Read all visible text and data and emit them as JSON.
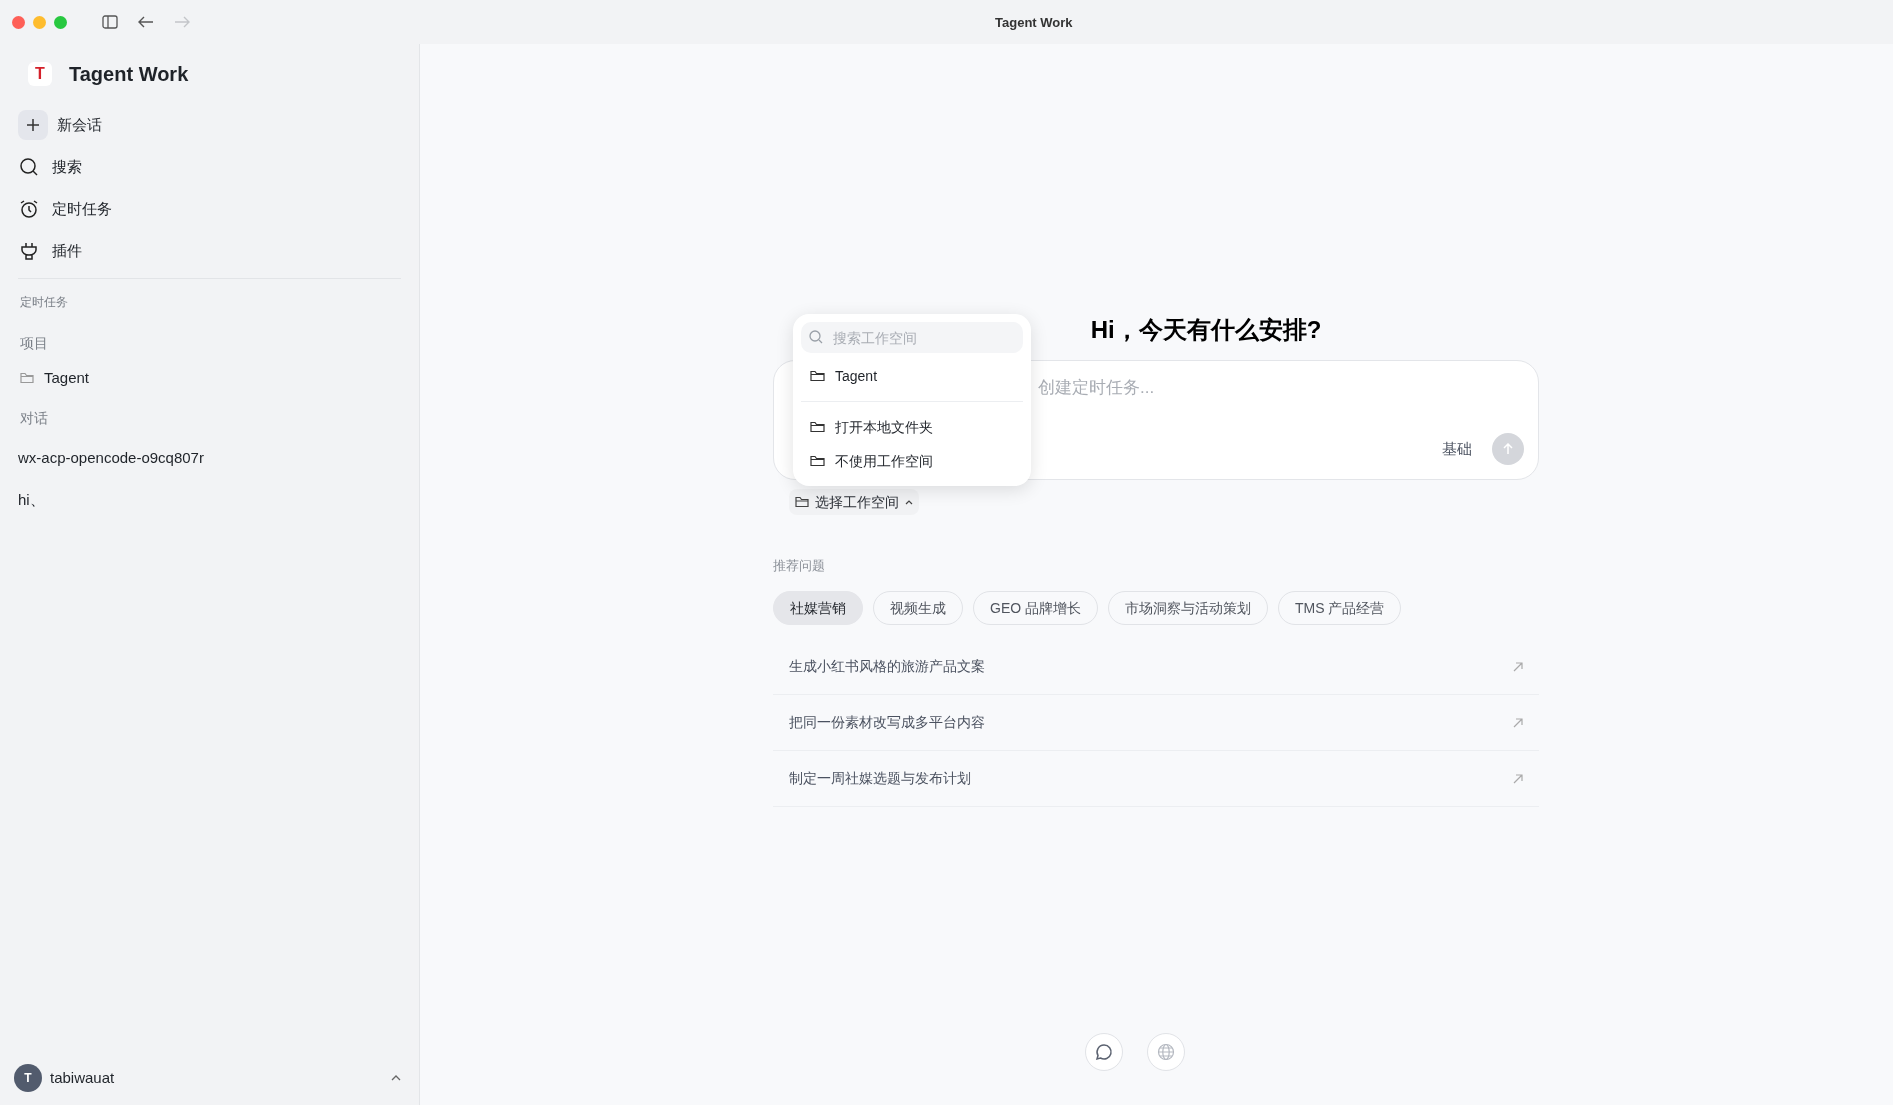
{
  "window": {
    "title": "Tagent Work"
  },
  "sidebar": {
    "logo": "T",
    "app_name": "Tagent Work",
    "nav": [
      {
        "label": "新会话",
        "kind": "new"
      },
      {
        "label": "搜索",
        "kind": "search"
      },
      {
        "label": "定时任务",
        "kind": "clock"
      },
      {
        "label": "插件",
        "kind": "plug"
      }
    ],
    "scheduled_heading": "定时任务",
    "projects_heading": "项目",
    "projects": [
      {
        "label": "Tagent"
      }
    ],
    "conversations_heading": "对话",
    "conversations": [
      {
        "label": "wx-acp-opencode-o9cq807r"
      },
      {
        "label": "hi、"
      }
    ],
    "user": {
      "initial": "T",
      "name": "tabiwauat"
    }
  },
  "main": {
    "greeting": "Hi，今天有什么安排?",
    "composer": {
      "placeholder": "创建定时任务...",
      "mode": "基础"
    },
    "workspace_button": "选择工作空间",
    "workspace_menu": {
      "search_placeholder": "搜索工作空间",
      "items": [
        {
          "label": "Tagent"
        }
      ],
      "actions": [
        {
          "label": "打开本地文件夹"
        },
        {
          "label": "不使用工作空间"
        }
      ]
    },
    "suggestions_heading": "推荐问题",
    "categories": [
      {
        "label": "社媒营销",
        "selected": true
      },
      {
        "label": "视频生成",
        "selected": false
      },
      {
        "label": "GEO 品牌增长",
        "selected": false
      },
      {
        "label": "市场洞察与活动策划",
        "selected": false
      },
      {
        "label": "TMS 产品经营",
        "selected": false
      }
    ],
    "prompts": [
      {
        "label": "生成小红书风格的旅游产品文案"
      },
      {
        "label": "把同一份素材改写成多平台内容"
      },
      {
        "label": "制定一周社媒选题与发布计划"
      }
    ]
  }
}
